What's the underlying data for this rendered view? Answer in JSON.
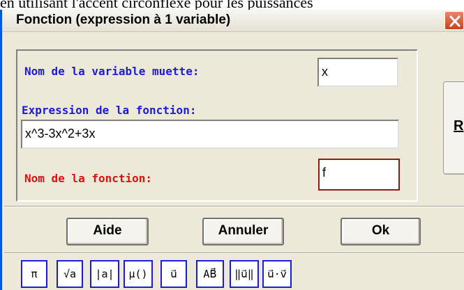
{
  "background_text": "en utilisant l'accent circonflexe pour les puissances",
  "window": {
    "title": "Fonction (expression à 1 variable)"
  },
  "form": {
    "var_label": "Nom de la variable muette:",
    "var_value": "x",
    "expr_label": "Expression de la fonction:",
    "expr_value": "x^3-3x^2+3x",
    "name_label": "Nom de la fonction:",
    "name_value": "f"
  },
  "side_button": {
    "label": "R"
  },
  "buttons": {
    "help": "Aide",
    "cancel": "Annuler",
    "ok": "Ok"
  },
  "symbols": [
    {
      "name": "pi",
      "label": "π"
    },
    {
      "name": "sqrt",
      "label": "√a"
    },
    {
      "name": "abs",
      "label": "|a|"
    },
    {
      "name": "mu",
      "label": "µ()"
    },
    {
      "name": "vector-u",
      "label": "u⃗"
    },
    {
      "name": "vector-ab",
      "label": "AB⃗"
    },
    {
      "name": "norm-u",
      "label": "‖u⃗‖"
    },
    {
      "name": "dot-product",
      "label": "u⃗·v⃗"
    }
  ],
  "colors": {
    "label_blue": "#1c1cd8",
    "label_red": "#e01010",
    "dialog_bg": "#ece9d8",
    "close_red": "#c8431f"
  }
}
